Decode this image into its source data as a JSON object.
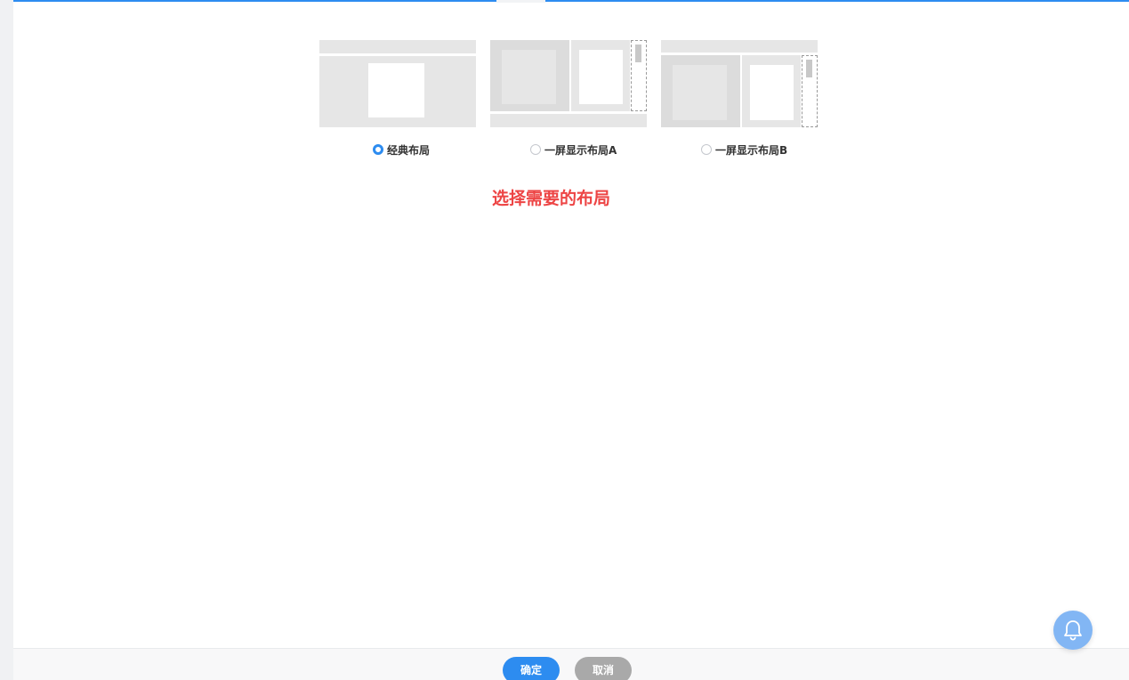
{
  "layouts": [
    {
      "id": "classic",
      "label": "经典布局",
      "selected": true
    },
    {
      "id": "one-screen-a",
      "label": "一屏显示布局A",
      "selected": false
    },
    {
      "id": "one-screen-b",
      "label": "一屏显示布局B",
      "selected": false
    }
  ],
  "hint": "选择需要的布局",
  "footer": {
    "confirm_label": "确定",
    "cancel_label": "取消"
  },
  "colors": {
    "accent": "#2d8cf0",
    "hint": "#ed4444",
    "cancel": "#a9a9a9",
    "bell": "#82b6f4"
  },
  "icons": {
    "notification": "bell-icon"
  }
}
